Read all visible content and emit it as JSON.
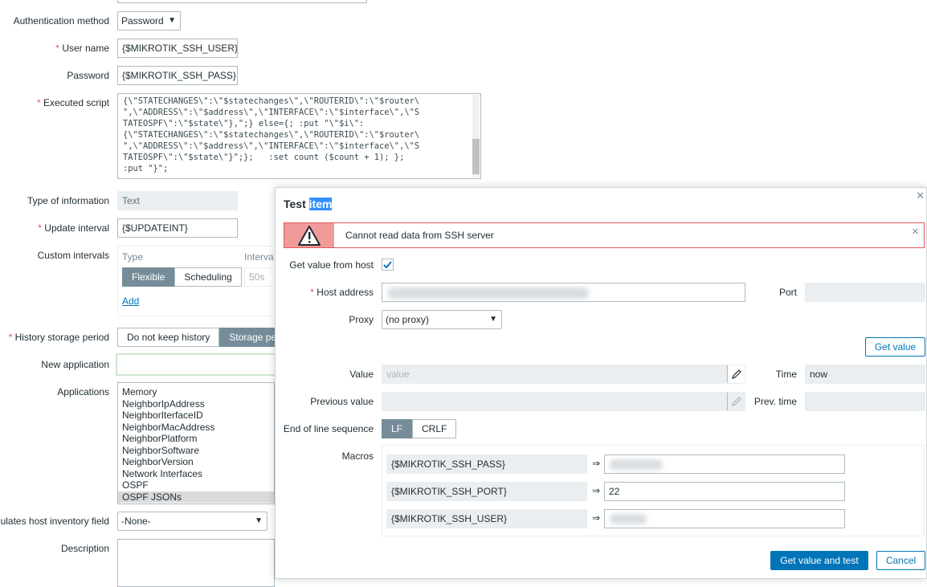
{
  "form": {
    "auth_label": "Authentication method",
    "auth_value": "Password",
    "username_label": "User name",
    "username_value": "{$MIKROTIK_SSH_USER}",
    "password_label": "Password",
    "password_value": "{$MIKROTIK_SSH_PASS}",
    "script_label": "Executed script",
    "script_lines": [
      "{\\\"STATECHANGES\\\":\\\"$statechanges\\\",\\\"ROUTERID\\\":\\\"$router\\",
      "\",\\\"ADDRESS\\\":\\\"$address\\\",\\\"INTERFACE\\\":\\\"$interface\\\",\\\"S",
      "TATEOSPF\\\":\\\"$state\\\"},\";} else={; :put \"\\\"$i\\\":",
      "{\\\"STATECHANGES\\\":\\\"$statechanges\\\",\\\"ROUTERID\\\":\\\"$router\\",
      "\",\\\"ADDRESS\\\":\\\"$address\\\",\\\"INTERFACE\\\":\\\"$interface\\\",\\\"S",
      "TATEOSPF\\\":\\\"$state\\\"}\";};   :set count ($count + 1); };",
      ":put \"}\";"
    ],
    "type_label": "Type of information",
    "type_value": "Text",
    "update_label": "Update interval",
    "update_value": "{$UPDATEINT}",
    "custom_label": "Custom intervals",
    "custom_type_header": "Type",
    "custom_interval_header": "Interva",
    "flexible_label": "Flexible",
    "scheduling_label": "Scheduling",
    "interval_placeholder": "50s",
    "add_label": "Add",
    "history_label": "History storage period",
    "history_no_keep": "Do not keep history",
    "history_storage": "Storage pe",
    "new_app_label": "New application",
    "apps_label": "Applications",
    "apps": [
      "Memory",
      "NeighborIpAddress",
      "NeighborIterfaceID",
      "NeighborMacAddress",
      "NeighborPlatform",
      "NeighborSoftware",
      "NeighborVersion",
      "Network Interfaces",
      "OSPF",
      "OSPF JSONs"
    ],
    "inventory_label": "ulates host inventory field",
    "inventory_value": "-None-",
    "description_label": "Description"
  },
  "modal": {
    "title_prefix": "Test ",
    "title_highlight": "item",
    "error_message": "Cannot read data from SSH server",
    "get_value_label": "Get value from host",
    "get_value_checked": true,
    "host_label": "Host address",
    "port_label": "Port",
    "proxy_label": "Proxy",
    "proxy_value": "(no proxy)",
    "get_value_button": "Get value",
    "value_label": "Value",
    "value_placeholder": "value",
    "time_label": "Time",
    "time_value": "now",
    "prev_value_label": "Previous value",
    "prev_time_label": "Prev. time",
    "eol_label": "End of line sequence",
    "eol_lf": "LF",
    "eol_crlf": "CRLF",
    "macros_label": "Macros",
    "macros": [
      {
        "name": "{$MIKROTIK_SSH_PASS}",
        "value": ""
      },
      {
        "name": "{$MIKROTIK_SSH_PORT}",
        "value": "22"
      },
      {
        "name": "{$MIKROTIK_SSH_USER}",
        "value": ""
      }
    ],
    "arrow": "⇒",
    "submit_button": "Get value and test",
    "cancel_button": "Cancel"
  },
  "colors": {
    "accent": "#0275b8",
    "error": "#e45959",
    "segment_active": "#768d99",
    "readonly": "#ebeef0"
  }
}
